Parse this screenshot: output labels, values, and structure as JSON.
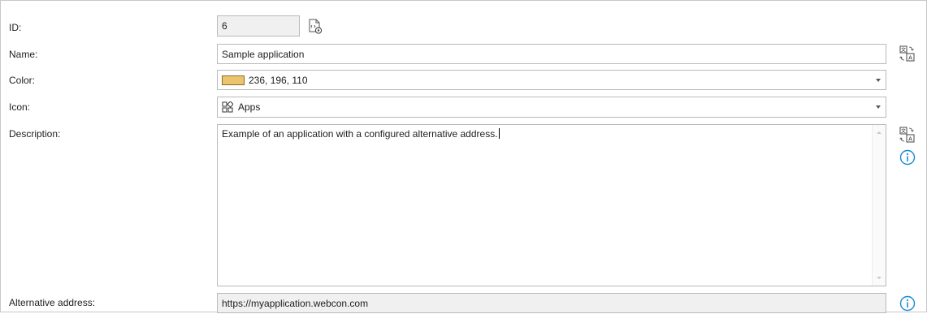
{
  "form": {
    "id": {
      "label": "ID:",
      "value": "6"
    },
    "name": {
      "label": "Name:",
      "value": "Sample application"
    },
    "color": {
      "label": "Color:",
      "value": "236, 196, 110",
      "swatch": "#ecc46e"
    },
    "icon": {
      "label": "Icon:",
      "value": "Apps",
      "icon_name": "apps-icon"
    },
    "description": {
      "label": "Description:",
      "value": "Example of an application with a configured alternative address."
    },
    "alternative_address": {
      "label": "Alternative address:",
      "value": "https://myapplication.webcon.com"
    }
  },
  "icons": {
    "id_settings": "document-settings-icon",
    "translate": "translate-icon",
    "info": "info-icon"
  },
  "colors": {
    "info_blue": "#1a8ad4",
    "border": "#b9b9b9",
    "readonly_bg": "#f0f0f0"
  }
}
